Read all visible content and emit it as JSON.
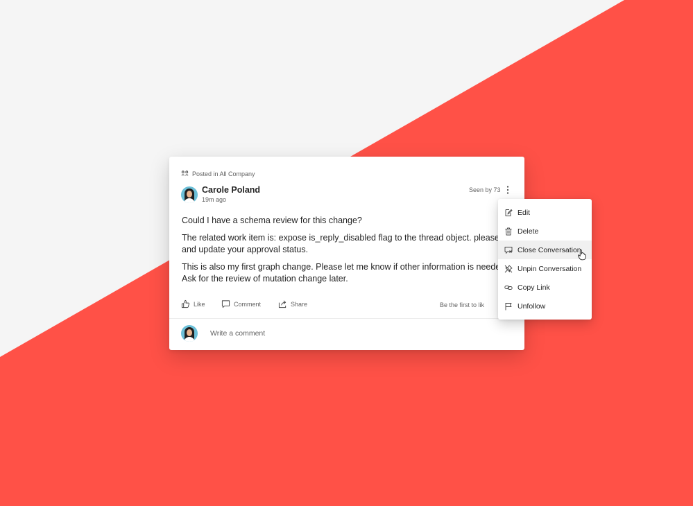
{
  "post": {
    "posted_in": "Posted in All Company",
    "author_name": "Carole Poland",
    "author_time": "19m ago",
    "seen_by": "Seen by 73",
    "body": [
      "Could I have a schema review for this change?",
      "The related work item is: expose is_reply_disabled flag to the thread object. please rev",
      "and update your approval status.",
      "This is also my first graph change. Please let me know if other information is needed.",
      "Ask for the review of mutation change later."
    ],
    "actions": {
      "like": "Like",
      "comment": "Comment",
      "share": "Share"
    },
    "first_to_like": "Be the first to lik",
    "comment_placeholder": "Write a comment"
  },
  "menu": {
    "items": [
      {
        "label": "Edit",
        "icon": "edit-icon"
      },
      {
        "label": "Delete",
        "icon": "delete-icon"
      },
      {
        "label": "Close Conversation",
        "icon": "close-conversation-icon",
        "hovered": true
      },
      {
        "label": "Unpin Conversation",
        "icon": "unpin-icon"
      },
      {
        "label": "Copy Link",
        "icon": "link-icon"
      },
      {
        "label": "Unfollow",
        "icon": "flag-icon"
      }
    ]
  },
  "colors": {
    "accent_red": "#ff5147",
    "background_light": "#f5f5f5",
    "text_primary": "#242424",
    "text_secondary": "#616161"
  }
}
